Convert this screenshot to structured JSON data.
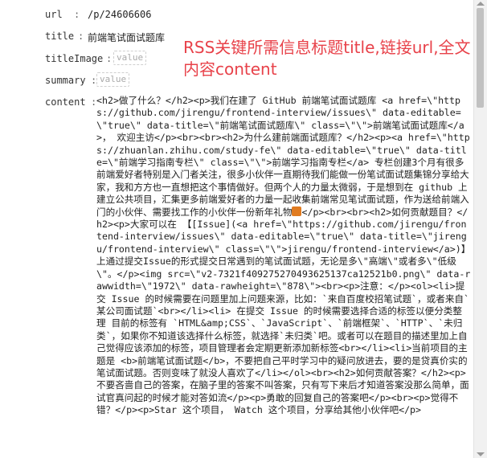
{
  "fields": {
    "url": {
      "key": "url",
      "sep": ":",
      "value": "/p/24606606"
    },
    "title": {
      "key": "title",
      "sep": ":",
      "value": "前端笔试面试题库"
    },
    "titleImage": {
      "key": "titleImage",
      "sep": ":",
      "placeholder": "value"
    },
    "summary": {
      "key": "summary",
      "sep": ":",
      "placeholder": "value"
    },
    "content": {
      "key": "content",
      "sep": ":"
    }
  },
  "content_parts": {
    "p1": "<h2>做了什么？</h2><p>我们在建了 GitHub 前端笔试面试题库 <a href=\\\"https://github.com/jirengu/frontend-interview/issues\\\" data-editable=\\\"true\\\" data-title=\\\"前端笔试面试题库\\\" class=\\\"\\\">前端笔试面试题库</a>， 欢迎主访</p><br><br><h2>为什么建前端面试题库？</h2><p><a href=\\\"https://zhuanlan.zhihu.com/study-fe\\\" data-editable=\\\"true\\\" data-title=\\\"前端学习指南专栏\\\" class=\\\"\\\">前端学习指南专栏</a> 专栏创建3个月有很多前端爱好者特别是入门者关注，很多小伙伴一直期待我们能做一份笔试面试题集锦分享给大家，我和方方也一直想把这个事情做好。但两个人的力量太微弱，于是想到在 github 上建立公共项目，汇集更多前端爱好者的力量一起收集前端常见笔试面试题，作为送给前端入门的小伙伴、需要找工作的小伙伴一份新年礼物",
    "p2": "</p><br><br><h2>如何贡献题目？</h2><p>大家可以在 【[Issue](<a href=\\\"https://github.com/jirengu/frontend-interview/issues\\\" data-editable=\\\"true\\\" data-title=\\\"jirengu/frontend-interview\\\" class=\\\"\\\">jirengu/frontend-interview</a>)】上通过提交Issue的形式提交日常遇到的笔试面试题，无论是多\\\"高端\\\"或者多\\\"低级\\\"。</p><img src=\\\"v2-7321f409275270493625137ca12521b0.png\\\" data-rawwidth=\\\"1972\\\" data-rawheight=\\\"878\\\"><br><p>注意：</p><ol><li>提交 Issue 的时候需要在问题里加上问题来源，比如：`来自百度校招笔试题`，或者来自`某公司面试题`<br></li><li> 在提交 Issue 的时候需要选择合适的标签以便分类整理 目前的标签有 `HTML&amp;CSS`、`JavaScript`、`前端框架`、`HTTP`、`未归类`，如果你不知道该选择什么标签，就选择`未归类`吧。或者可以在题目的描述里加上自己觉得应该添加的标签，项目管理者会定期更新添加新标签<br></li><li>当前项目的主题是 <b>前端笔试面试题</b>，不要把自己平时学习中的疑问放进去，要的是贷真价实的笔试面试题。否则变味了就没人喜欢了</li></ol><br><h2>如何贡献答案？</h2><p>不要吝啬自己的答案，在脑子里的答案不叫答案，只有写下来后才知道答案没那么简单，面试官真问起的时候才能对答如流</p><p>勇敢的回复自己的答案吧</p><br><p>觉得不错？</p><p>Star 这个项目， Watch 这个项目，分享给其他小伙伴吧</p>"
  },
  "annotation": "RSS关键所需信息标题title,链接url,全文内容content",
  "colors": {
    "annotation": "#e8424a",
    "icon": "#e07b20"
  },
  "icons": {
    "gift": "gift-icon"
  }
}
